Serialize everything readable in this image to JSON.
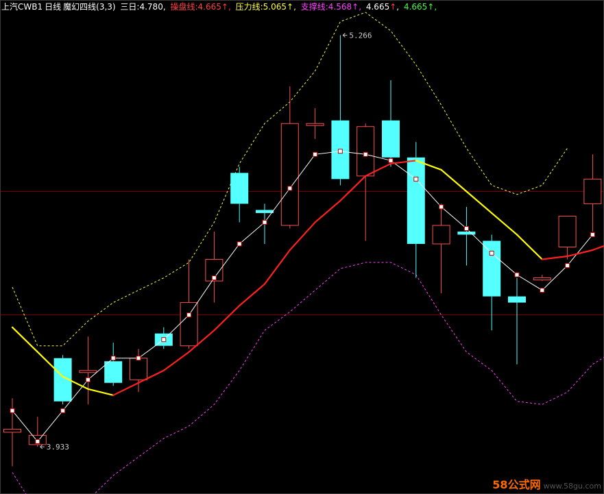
{
  "header": {
    "stock": "上汽CWB1",
    "period": "日线",
    "indicator": "魔幻四线(3,3)",
    "sanri_label": "三日:",
    "sanri_value": "4.780",
    "caopan_label": "操盘线:",
    "caopan_value": "4.665",
    "yali_label": "压力线:",
    "yali_value": "5.065",
    "zhicheng_label": "支撑线:",
    "zhicheng_value": "4.568",
    "extra1_value": "4.665",
    "extra2_value": "4.665",
    "arrow": "↑",
    "comma": ","
  },
  "colors": {
    "up_candle": "#ff5050",
    "down_candle": "#54ffff",
    "sanri": "#ffffff",
    "caopan_up": "#ff2020",
    "caopan_down": "#ffff00",
    "yali": "#ffff40",
    "zhicheng": "#ff40ff",
    "grid": "#800000",
    "label_sanri": "#ffffff",
    "label_caopan": "#ff4040",
    "label_yali": "#ffff40",
    "label_zhicheng": "#ff40ff",
    "label_green": "#40ff40"
  },
  "chart_data": {
    "type": "candlestick",
    "price_range": [
      3.8,
      5.34
    ],
    "gridlines": [
      4.76,
      4.36
    ],
    "candles": [
      {
        "open": 3.98,
        "close": 3.99,
        "high": 4.09,
        "low": 3.87
      },
      {
        "open": 3.94,
        "close": 3.97,
        "high": 4.03,
        "low": 3.933
      },
      {
        "open": 4.22,
        "close": 4.08,
        "high": 4.23,
        "low": 4.07
      },
      {
        "open": 4.18,
        "close": 4.18,
        "high": 4.29,
        "low": 4.07
      },
      {
        "open": 4.21,
        "close": 4.14,
        "high": 4.27,
        "low": 4.13
      },
      {
        "open": 4.15,
        "close": 4.22,
        "high": 4.25,
        "low": 4.11
      },
      {
        "open": 4.3,
        "close": 4.26,
        "high": 4.32,
        "low": 4.25
      },
      {
        "open": 4.26,
        "close": 4.4,
        "high": 4.54,
        "low": 4.25
      },
      {
        "open": 4.47,
        "close": 4.54,
        "high": 4.63,
        "low": 4.4
      },
      {
        "open": 4.82,
        "close": 4.72,
        "high": 4.84,
        "low": 4.66
      },
      {
        "open": 4.7,
        "close": 4.69,
        "high": 4.72,
        "low": 4.59
      },
      {
        "open": 4.65,
        "close": 4.98,
        "high": 5.1,
        "low": 4.64
      },
      {
        "open": 4.98,
        "close": 4.98,
        "high": 5.03,
        "low": 4.93
      },
      {
        "open": 4.99,
        "close": 4.8,
        "high": 5.266,
        "low": 4.78
      },
      {
        "open": 4.81,
        "close": 4.97,
        "high": 4.98,
        "low": 4.6
      },
      {
        "open": 4.99,
        "close": 4.87,
        "high": 5.12,
        "low": 4.84
      },
      {
        "open": 4.87,
        "close": 4.59,
        "high": 4.92,
        "low": 4.48
      },
      {
        "open": 4.59,
        "close": 4.65,
        "high": 4.72,
        "low": 4.43
      },
      {
        "open": 4.63,
        "close": 4.62,
        "high": 4.71,
        "low": 4.52
      },
      {
        "open": 4.6,
        "close": 4.42,
        "high": 4.62,
        "low": 4.31
      },
      {
        "open": 4.42,
        "close": 4.4,
        "high": 4.48,
        "low": 4.2
      },
      {
        "open": 4.48,
        "close": 4.48,
        "high": 4.49,
        "low": 4.47
      },
      {
        "open": 4.58,
        "close": 4.68,
        "high": 4.68,
        "low": 4.54
      },
      {
        "open": 4.72,
        "close": 4.8,
        "high": 4.88,
        "low": 4.63
      }
    ],
    "sanri": [
      4.05,
      3.95,
      4.05,
      4.15,
      4.22,
      4.22,
      4.28,
      4.36,
      4.48,
      4.59,
      4.66,
      4.77,
      4.88,
      4.89,
      4.88,
      4.86,
      4.8,
      4.71,
      4.64,
      4.56,
      4.49,
      4.44,
      4.52,
      4.62
    ],
    "caopan": [
      4.32,
      4.24,
      4.16,
      4.12,
      4.1,
      4.14,
      4.18,
      4.24,
      4.31,
      4.39,
      4.46,
      4.57,
      4.66,
      4.73,
      4.81,
      4.85,
      4.86,
      4.83,
      4.76,
      4.69,
      4.62,
      4.54,
      4.55,
      4.57,
      4.6
    ],
    "yali": [
      4.45,
      4.26,
      4.26,
      4.34,
      4.4,
      4.44,
      4.48,
      4.53,
      4.66,
      4.85,
      4.98,
      5.05,
      5.15,
      5.31,
      5.34,
      5.28,
      5.17,
      5.04,
      4.9,
      4.78,
      4.75,
      4.78,
      4.9
    ],
    "zhicheng": [
      3.85,
      3.72,
      3.72,
      3.76,
      3.84,
      3.9,
      3.96,
      4.0,
      4.07,
      4.18,
      4.31,
      4.37,
      4.44,
      4.51,
      4.53,
      4.53,
      4.49,
      4.36,
      4.24,
      4.18,
      4.08,
      4.07,
      4.11,
      4.2,
      4.25
    ],
    "annotations": [
      {
        "text": "5.266",
        "candle": 13,
        "price": 5.266
      },
      {
        "text": "3.933",
        "candle": 1,
        "price": 3.933
      }
    ]
  },
  "watermark": {
    "brand": "58公式网",
    "site": "www.58gu.com"
  }
}
